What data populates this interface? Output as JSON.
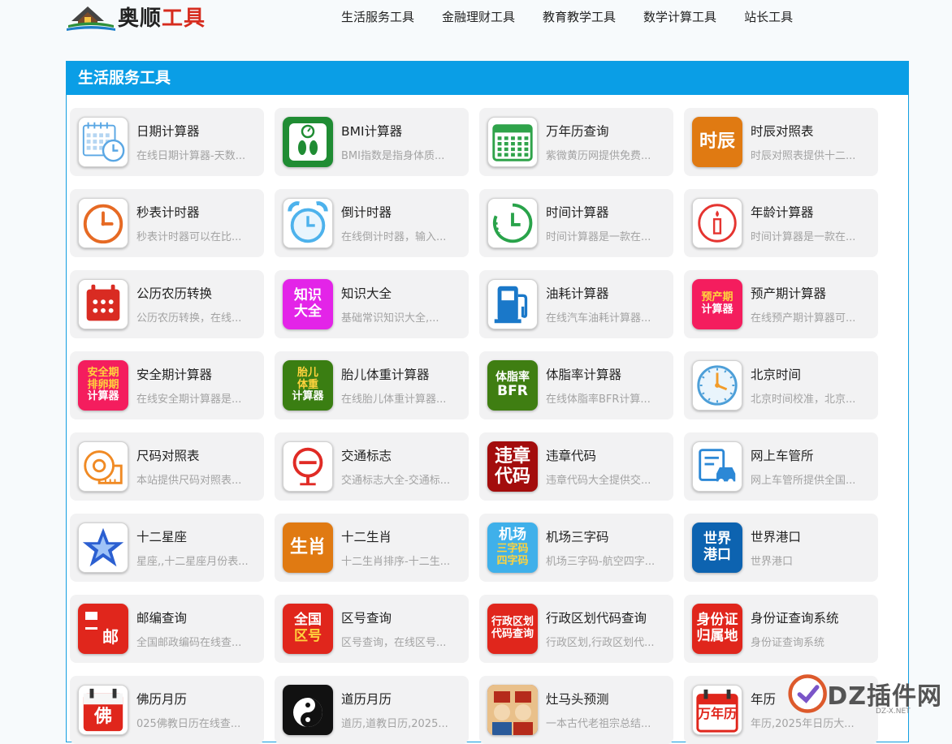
{
  "site": {
    "logo_dark": "奥顺",
    "logo_red": "工具"
  },
  "nav": [
    "生活服务工具",
    "金融理财工具",
    "教育教学工具",
    "数学计算工具",
    "站长工具"
  ],
  "section": {
    "title": "生活服务工具"
  },
  "tools": [
    {
      "title": "日期计算器",
      "desc": "在线日期计算器-天数...",
      "icon": "calendar-clock-icon"
    },
    {
      "title": "BMI计算器",
      "desc": "BMI指数是指身体质...",
      "icon": "scale-icon"
    },
    {
      "title": "万年历查询",
      "desc": "紫微黄历网提供免费...",
      "icon": "calendar-grid-icon"
    },
    {
      "title": "时辰对照表",
      "desc": "时辰对照表提供十二...",
      "icon": "shichen-icon",
      "icon_text": "时辰"
    },
    {
      "title": "秒表计时器",
      "desc": "秒表计时器可以在比...",
      "icon": "stopwatch-icon"
    },
    {
      "title": "倒计时器",
      "desc": "在线倒计时器，输入...",
      "icon": "alarm-clock-icon"
    },
    {
      "title": "时间计算器",
      "desc": "时间计算器是一款在...",
      "icon": "clock-icon"
    },
    {
      "title": "年龄计算器",
      "desc": "时间计算器是一款在...",
      "icon": "candle-icon"
    },
    {
      "title": "公历农历转换",
      "desc": "公历农历转换，在线...",
      "icon": "calendar-red-icon"
    },
    {
      "title": "知识大全",
      "desc": "基础常识知识大全,...",
      "icon": "knowledge-icon",
      "icon_text": "知识\n大全"
    },
    {
      "title": "油耗计算器",
      "desc": "在线汽车油耗计算器...",
      "icon": "fuel-pump-icon"
    },
    {
      "title": "预产期计算器",
      "desc": "在线预产期计算器可...",
      "icon": "due-date-icon",
      "icon_text": "预产期\n计算器"
    },
    {
      "title": "安全期计算器",
      "desc": "在线安全期计算器是...",
      "icon": "safe-period-icon",
      "icon_text": "安全期\n排卵期\n计算器"
    },
    {
      "title": "胎儿体重计算器",
      "desc": "在线胎儿体重计算器...",
      "icon": "fetal-weight-icon",
      "icon_text": "胎儿\n体重\n计算器"
    },
    {
      "title": "体脂率计算器",
      "desc": "在线体脂率BFR计算...",
      "icon": "body-fat-icon",
      "icon_text": "体脂率\nBFR"
    },
    {
      "title": "北京时间",
      "desc": "北京时间校准，北京...",
      "icon": "beijing-clock-icon"
    },
    {
      "title": "尺码对照表",
      "desc": "本站提供尺码对照表...",
      "icon": "tape-measure-icon"
    },
    {
      "title": "交通标志",
      "desc": "交通标志大全-交通标...",
      "icon": "traffic-sign-icon"
    },
    {
      "title": "违章代码",
      "desc": "违章代码大全提供交...",
      "icon": "violation-code-icon",
      "icon_text": "违章\n代码"
    },
    {
      "title": "网上车管所",
      "desc": "网上车管所提供全国...",
      "icon": "car-office-icon"
    },
    {
      "title": "十二星座",
      "desc": "星座,,十二星座月份表...",
      "icon": "star-icon"
    },
    {
      "title": "十二生肖",
      "desc": "十二生肖排序-十二生...",
      "icon": "zodiac-icon",
      "icon_text": "生肖"
    },
    {
      "title": "机场三字码",
      "desc": "机场三字码-航空四字...",
      "icon": "airport-code-icon",
      "icon_text": "机场\n三字码\n四字码"
    },
    {
      "title": "世界港口",
      "desc": "世界港口",
      "icon": "world-port-icon",
      "icon_text": "世界\n港口"
    },
    {
      "title": "邮编查询",
      "desc": "全国邮政编码在线查...",
      "icon": "postal-icon",
      "icon_text": "邮"
    },
    {
      "title": "区号查询",
      "desc": "区号查询，在线区号...",
      "icon": "area-code-icon",
      "icon_text": "全国\n区号"
    },
    {
      "title": "行政区划代码查询",
      "desc": "行政区划,行政区划代...",
      "icon": "admin-code-icon",
      "icon_text": "行政区划\n代码查询"
    },
    {
      "title": "身份证查询系统",
      "desc": "身份证查询系统",
      "icon": "id-card-icon",
      "icon_text": "身份证\n归属地"
    },
    {
      "title": "佛历月历",
      "desc": "025佛教日历在线查...",
      "icon": "buddhist-calendar-icon",
      "icon_text": "佛"
    },
    {
      "title": "道历月历",
      "desc": "道历,道教日历,2025...",
      "icon": "taoist-calendar-icon"
    },
    {
      "title": "灶马头预测",
      "desc": "一本古代老祖宗总结...",
      "icon": "kitchen-god-icon"
    },
    {
      "title": "年历",
      "desc": "年历,2025年日历大...",
      "icon": "year-calendar-icon",
      "icon_text": "万年历"
    }
  ],
  "watermark": {
    "text": "DZ插件网",
    "sub": "DZ-X.NET"
  }
}
